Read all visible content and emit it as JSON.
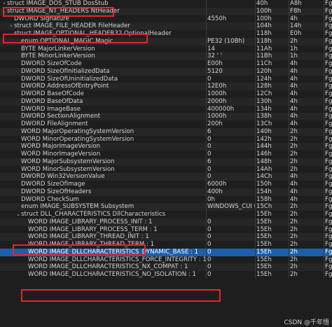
{
  "rows": [
    {
      "name": "struct IMAGE_DOS_STUB DosStub",
      "value": "",
      "start": "40h",
      "size": "A8h",
      "color": "Fg",
      "arrow": "›",
      "indent": 0
    },
    {
      "name": "struct IMAGE_NT_HEADERS NtHeader",
      "value": "",
      "start": "100h",
      "size": "F8h",
      "color": "Fg",
      "arrow": "⌄",
      "indent": 0
    },
    {
      "name": "DWORD Signature",
      "value": "4550h",
      "start": "100h",
      "size": "4h",
      "color": "Fg",
      "arrow": "",
      "indent": 1
    },
    {
      "name": "struct IMAGE_FILE_HEADER FileHeader",
      "value": "",
      "start": "104h",
      "size": "14h",
      "color": "Fg",
      "arrow": "›",
      "indent": 1
    },
    {
      "name": "struct IMAGE_OPTIONAL_HEADER32 OptionalHeader",
      "value": "",
      "start": "118h",
      "size": "E0h",
      "color": "Fg",
      "arrow": "⌄",
      "indent": 1
    },
    {
      "name": "enum OPTIONAL_MAGIC Magic",
      "value": "PE32 (10Bh)",
      "start": "118h",
      "size": "2h",
      "color": "Fg",
      "arrow": "",
      "indent": 2
    },
    {
      "name": "BYTE MajorLinkerVersion",
      "value": "14",
      "start": "11Ah",
      "size": "1h",
      "color": "Fg",
      "arrow": "",
      "indent": 2
    },
    {
      "name": "BYTE MinorLinkerVersion",
      "value": "32 ' '",
      "start": "11Bh",
      "size": "1h",
      "color": "Fg",
      "arrow": "",
      "indent": 2
    },
    {
      "name": "DWORD SizeOfCode",
      "value": "E00h",
      "start": "11Ch",
      "size": "4h",
      "color": "Fg",
      "arrow": "",
      "indent": 2
    },
    {
      "name": "DWORD SizeOfInitializedData",
      "value": "5120",
      "start": "120h",
      "size": "4h",
      "color": "Fg",
      "arrow": "",
      "indent": 2
    },
    {
      "name": "DWORD SizeOfUninitializedData",
      "value": "0",
      "start": "124h",
      "size": "4h",
      "color": "Fg",
      "arrow": "",
      "indent": 2
    },
    {
      "name": "DWORD AddressOfEntryPoint",
      "value": "12E0h",
      "start": "128h",
      "size": "4h",
      "color": "Fg",
      "arrow": "",
      "indent": 2
    },
    {
      "name": "DWORD BaseOfCode",
      "value": "1000h",
      "start": "12Ch",
      "size": "4h",
      "color": "Fg",
      "arrow": "",
      "indent": 2
    },
    {
      "name": "DWORD BaseOfData",
      "value": "2000h",
      "start": "130h",
      "size": "4h",
      "color": "Fg",
      "arrow": "",
      "indent": 2
    },
    {
      "name": "DWORD ImageBase",
      "value": "400000h",
      "start": "134h",
      "size": "4h",
      "color": "Fg",
      "arrow": "",
      "indent": 2
    },
    {
      "name": "DWORD SectionAlignment",
      "value": "1000h",
      "start": "138h",
      "size": "4h",
      "color": "Fg",
      "arrow": "",
      "indent": 2
    },
    {
      "name": "DWORD FileAlignment",
      "value": "200h",
      "start": "13Ch",
      "size": "4h",
      "color": "Fg",
      "arrow": "",
      "indent": 2
    },
    {
      "name": "WORD MajorOperatingSystemVersion",
      "value": "6",
      "start": "140h",
      "size": "2h",
      "color": "Fg",
      "arrow": "",
      "indent": 2
    },
    {
      "name": "WORD MinorOperatingSystemVersion",
      "value": "0",
      "start": "142h",
      "size": "2h",
      "color": "Fg",
      "arrow": "",
      "indent": 2
    },
    {
      "name": "WORD MajorImageVersion",
      "value": "0",
      "start": "144h",
      "size": "2h",
      "color": "Fg",
      "arrow": "",
      "indent": 2
    },
    {
      "name": "WORD MinorImageVersion",
      "value": "0",
      "start": "146h",
      "size": "2h",
      "color": "Fg",
      "arrow": "",
      "indent": 2
    },
    {
      "name": "WORD MajorSubsystemVersion",
      "value": "6",
      "start": "148h",
      "size": "2h",
      "color": "Fg",
      "arrow": "",
      "indent": 2
    },
    {
      "name": "WORD MinorSubsystemVersion",
      "value": "0",
      "start": "14Ah",
      "size": "2h",
      "color": "Fg",
      "arrow": "",
      "indent": 2
    },
    {
      "name": "DWORD Win32VersionValue",
      "value": "0",
      "start": "14Ch",
      "size": "4h",
      "color": "Fg",
      "arrow": "",
      "indent": 2
    },
    {
      "name": "DWORD SizeOfImage",
      "value": "6000h",
      "start": "150h",
      "size": "4h",
      "color": "Fg",
      "arrow": "",
      "indent": 2
    },
    {
      "name": "DWORD SizeOfHeaders",
      "value": "400h",
      "start": "154h",
      "size": "4h",
      "color": "Fg",
      "arrow": "",
      "indent": 2
    },
    {
      "name": "DWORD CheckSum",
      "value": "0h",
      "start": "158h",
      "size": "4h",
      "color": "Fg",
      "arrow": "",
      "indent": 2
    },
    {
      "name": "enum IMAGE_SUBSYSTEM Subsystem",
      "value": "WINDOWS_CUI (3)",
      "start": "15Ch",
      "size": "2h",
      "color": "Fg",
      "arrow": "",
      "indent": 2
    },
    {
      "name": "struct DLL_CHARACTERISTICS DllCharacteristics",
      "value": "",
      "start": "15Eh",
      "size": "2h",
      "color": "Fg",
      "arrow": "⌄",
      "indent": 2
    },
    {
      "name": "WORD IMAGE_LIBRARY_PROCESS_INIT : 1",
      "value": "0",
      "start": "15Eh",
      "size": "2h",
      "color": "Fg",
      "arrow": "",
      "indent": 3
    },
    {
      "name": "WORD IMAGE_LIBRARY_PROCESS_TERM : 1",
      "value": "0",
      "start": "15Eh",
      "size": "2h",
      "color": "Fg",
      "arrow": "",
      "indent": 3
    },
    {
      "name": "WORD IMAGE_LIBRARY_THREAD_INIT : 1",
      "value": "0",
      "start": "15Eh",
      "size": "2h",
      "color": "Fg",
      "arrow": "",
      "indent": 3
    },
    {
      "name": "WORD IMAGE_LIBRARY_THREAD_TERM : 1",
      "value": "0",
      "start": "15Eh",
      "size": "2h",
      "color": "Fg",
      "arrow": "",
      "indent": 3
    },
    {
      "name": "WORD IMAGE_DLLCHARACTERISTICS_DYNAMIC_BASE : 1",
      "value": "0",
      "start": "15Eh",
      "size": "2h",
      "color": "Fg",
      "arrow": "",
      "indent": 3
    },
    {
      "name": "WORD IMAGE_DLLCHARACTERISTICS_FORCE_INTEGRITY : 1",
      "value": "0",
      "start": "15Eh",
      "size": "2h",
      "color": "Fg",
      "arrow": "",
      "indent": 3
    },
    {
      "name": "WORD IMAGE_DLLCHARACTERISTICS_NX_COMPAT : 1",
      "value": "0",
      "start": "15Eh",
      "size": "2h",
      "color": "Fg",
      "arrow": "",
      "indent": 3
    },
    {
      "name": "WORD IMAGE_DLLCHARACTERISTICS_NO_ISOLATION : 1",
      "value": "0",
      "start": "15Eh",
      "size": "2h",
      "color": "Fg",
      "arrow": "",
      "indent": 3
    }
  ],
  "selected_row": 33,
  "watermark": "CSDN @千年悟",
  "colors": {
    "background": "#1e1e1e",
    "alt_row": "#262626",
    "selection": "#1c5fa8",
    "highlight_box": "#e3262e"
  }
}
